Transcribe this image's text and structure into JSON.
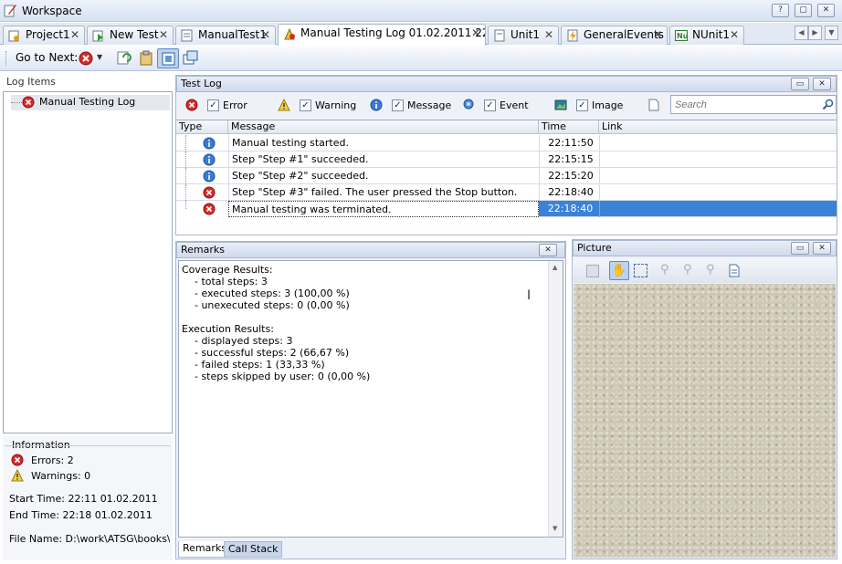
{
  "window": {
    "title": "Workspace",
    "help": "?",
    "restore": "▢",
    "close": "✕"
  },
  "tabs": [
    {
      "label": "Project1",
      "icon": "project-icon"
    },
    {
      "label": "New Test",
      "icon": "test-icon"
    },
    {
      "label": "ManualTest1",
      "icon": "manual-test-icon"
    },
    {
      "label": "Manual Testing Log 01.02.2011 22...",
      "icon": "log-icon",
      "active": true
    },
    {
      "label": "Unit1",
      "icon": "unit-icon"
    },
    {
      "label": "GeneralEvents",
      "icon": "events-icon"
    },
    {
      "label": "NUnit1",
      "icon": "nunit-icon"
    }
  ],
  "tab_close": "✕",
  "toolbar": {
    "goto_label": "Go to Next:"
  },
  "log_items": {
    "header": "Log Items",
    "items": [
      {
        "label": "Manual Testing Log",
        "status": "error"
      }
    ]
  },
  "information": {
    "header": "Information",
    "errors": "Errors: 2",
    "warnings": "Warnings: 0",
    "start_time": "Start Time: 22:11 01.02.2011",
    "end_time": "End Time: 22:18 01.02.2011",
    "file_name": "File Name: D:\\work\\ATSG\\books\\Te"
  },
  "test_log": {
    "header": "Test Log",
    "filters": [
      {
        "label": "Error",
        "checked": true
      },
      {
        "label": "Warning",
        "checked": true
      },
      {
        "label": "Message",
        "checked": true
      },
      {
        "label": "Event",
        "checked": true
      },
      {
        "label": "Image",
        "checked": true
      }
    ],
    "search_placeholder": "Search",
    "columns": [
      "Type",
      "Message",
      "Time",
      "Link"
    ],
    "rows": [
      {
        "type": "message",
        "message": "Manual testing started.",
        "time": "22:11:50",
        "link": ""
      },
      {
        "type": "message",
        "message": "Step \"Step #1\" succeeded.",
        "time": "22:15:15",
        "link": ""
      },
      {
        "type": "message",
        "message": "Step \"Step #2\" succeeded.",
        "time": "22:15:20",
        "link": ""
      },
      {
        "type": "error",
        "message": "Step \"Step #3\" failed. The user pressed the Stop button.",
        "time": "22:18:40",
        "link": ""
      },
      {
        "type": "error",
        "message": "Manual testing was terminated.",
        "time": "22:18:40",
        "link": "",
        "selected": true
      }
    ]
  },
  "remarks": {
    "header": "Remarks",
    "lines": [
      "Coverage Results:",
      "    - total steps: 3",
      "    - executed steps: 3 (100,00 %)",
      "    - unexecuted steps: 0 (0,00 %)",
      "",
      "Execution Results:",
      "    - displayed steps: 3",
      "    - successful steps: 2 (66,67 %)",
      "    - failed steps: 1 (33,33 %)",
      "    - steps skipped by user: 0 (0,00 %)"
    ],
    "tabs": [
      "Remarks",
      "Call Stack"
    ]
  },
  "picture": {
    "header": "Picture"
  },
  "colors": {
    "selection": "#3a83d6",
    "error": "#d62b2b",
    "panel": "#eef2f8"
  }
}
